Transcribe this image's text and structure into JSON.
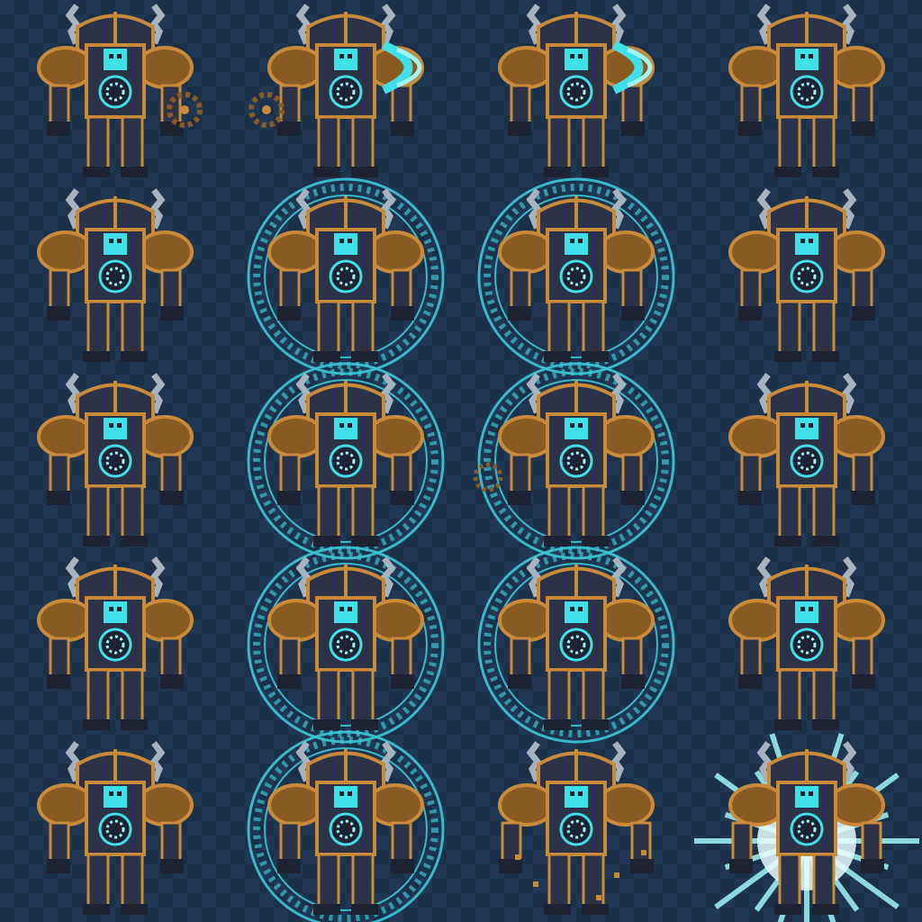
{
  "sprite_sheet": {
    "columns": 4,
    "rows": 5,
    "colors": {
      "background_light": "#1f3753",
      "background_dark": "#1a2f48",
      "armor_dark": "#2b3247",
      "armor_shadow": "#1d2233",
      "trim_gold": "#c98b3a",
      "trim_gold_dark": "#8a5a23",
      "core_cyan": "#3fe0e8",
      "core_glow": "#9ff6f8",
      "steam_gray": "#a9b3bf",
      "rune_cyan": "#3cc8d6"
    },
    "frames": [
      {
        "effect": "gear-throw"
      },
      {
        "effect": "energy-blast-left"
      },
      {
        "effect": "energy-blast-right"
      },
      {
        "effect": "idle"
      },
      {
        "effect": "idle"
      },
      {
        "effect": "rune-circle"
      },
      {
        "effect": "rune-circle"
      },
      {
        "effect": "idle"
      },
      {
        "effect": "idle"
      },
      {
        "effect": "rune-circle"
      },
      {
        "effect": "rune-circle-gear"
      },
      {
        "effect": "idle"
      },
      {
        "effect": "idle"
      },
      {
        "effect": "rune-circle"
      },
      {
        "effect": "rune-circle"
      },
      {
        "effect": "idle"
      },
      {
        "effect": "idle"
      },
      {
        "effect": "rune-circle"
      },
      {
        "effect": "debris"
      },
      {
        "effect": "burst"
      }
    ]
  }
}
